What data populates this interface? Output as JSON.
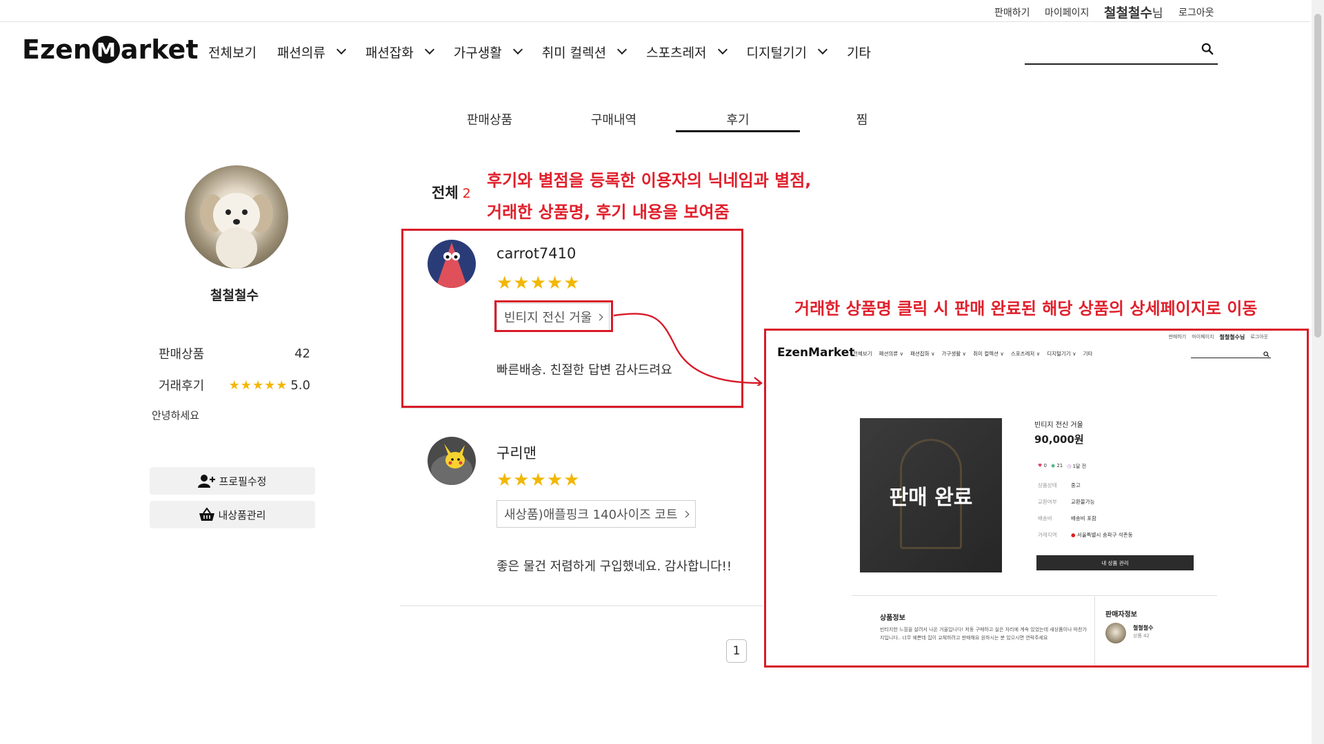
{
  "topbar": {
    "sell": "판매하기",
    "mypage": "마이페이지",
    "username": "철철철수",
    "username_suffix": "님",
    "logout": "로그아웃"
  },
  "header": {
    "logo_left": "Ezen",
    "logo_m": "M",
    "logo_right": "arket",
    "nav": [
      "전체보기",
      "패션의류",
      "패션잡화",
      "가구생활",
      "취미 컬렉션",
      "스포츠레저",
      "디지털기기",
      "기타"
    ],
    "search_placeholder": ""
  },
  "tabs": [
    "판매상품",
    "구매내역",
    "후기",
    "찜"
  ],
  "active_tab": "후기",
  "profile": {
    "name": "철철철수",
    "sales_label": "판매상품",
    "sales_count": "42",
    "review_label": "거래후기",
    "review_stars": "★★★★★",
    "review_score": "5.0",
    "greeting": "안녕하세요",
    "edit_button": "프로필수정",
    "manage_button": "내상품관리"
  },
  "reviews_header": {
    "label": "전체",
    "count": "2"
  },
  "annotations": {
    "line1": "후기와 별점을 등록한 이용자의 닉네임과 별점,",
    "line2": "거래한 상품명, 후기 내용을 보여줌",
    "line3": "거래한 상품명 클릭 시 판매 완료된  해당 상품의 상세페이지로 이동"
  },
  "reviews": [
    {
      "nickname": "carrot7410",
      "stars": "★★★★★",
      "product": "빈티지 전신 거울",
      "text": "빠른배송. 친절한 답변 감사드려요"
    },
    {
      "nickname": "구리맨",
      "stars": "★★★★★",
      "product": "새상품)애플핑크 140사이즈 코트",
      "text": "좋은 물건 저렴하게 구입했네요. 감사합니다!!"
    }
  ],
  "pagination": {
    "current": "1"
  },
  "mini_page": {
    "top_sell": "판매하기",
    "top_mypage": "마이페이지",
    "top_user": "철철철수님",
    "top_logout": "로그아웃",
    "logo": "EzenMarket",
    "nav": [
      "전체보기",
      "패션의류 ∨",
      "패션잡화 ∨",
      "가구생활 ∨",
      "취미 컬렉션 ∨",
      "스포츠레저 ∨",
      "디지털기기 ∨",
      "기타"
    ],
    "sold_label": "판매 완료",
    "title": "빈티지 전신 거울",
    "price": "90,000원",
    "likes": "0",
    "views": "21",
    "time": "1달 전",
    "rows": [
      {
        "k": "상품상태",
        "v": "중고"
      },
      {
        "k": "교환여부",
        "v": "교환불가능"
      },
      {
        "k": "배송비",
        "v": "배송비 포함"
      },
      {
        "k": "거래지역",
        "v": "서울특별시 송파구 석촌동"
      }
    ],
    "manage_button": "내 상품 관리",
    "info_title": "상품정보",
    "info_text": "빈티지한 느낌을 살려서 나온 거울입니다! 저동 구매하고 실은 자리에 계속 있었는데 새상품이나 마찬가지입니다.. 너무 예쁜데 집이 교체하려고 판매해요 원하시는 분 있으시면 연락주세요",
    "seller_title": "판매자정보",
    "seller_name": "철철철수",
    "seller_count": "상품 42"
  },
  "colors": {
    "annotation_red": "#e0202c",
    "star_yellow": "#f2b705",
    "brand_dark": "#111111"
  }
}
